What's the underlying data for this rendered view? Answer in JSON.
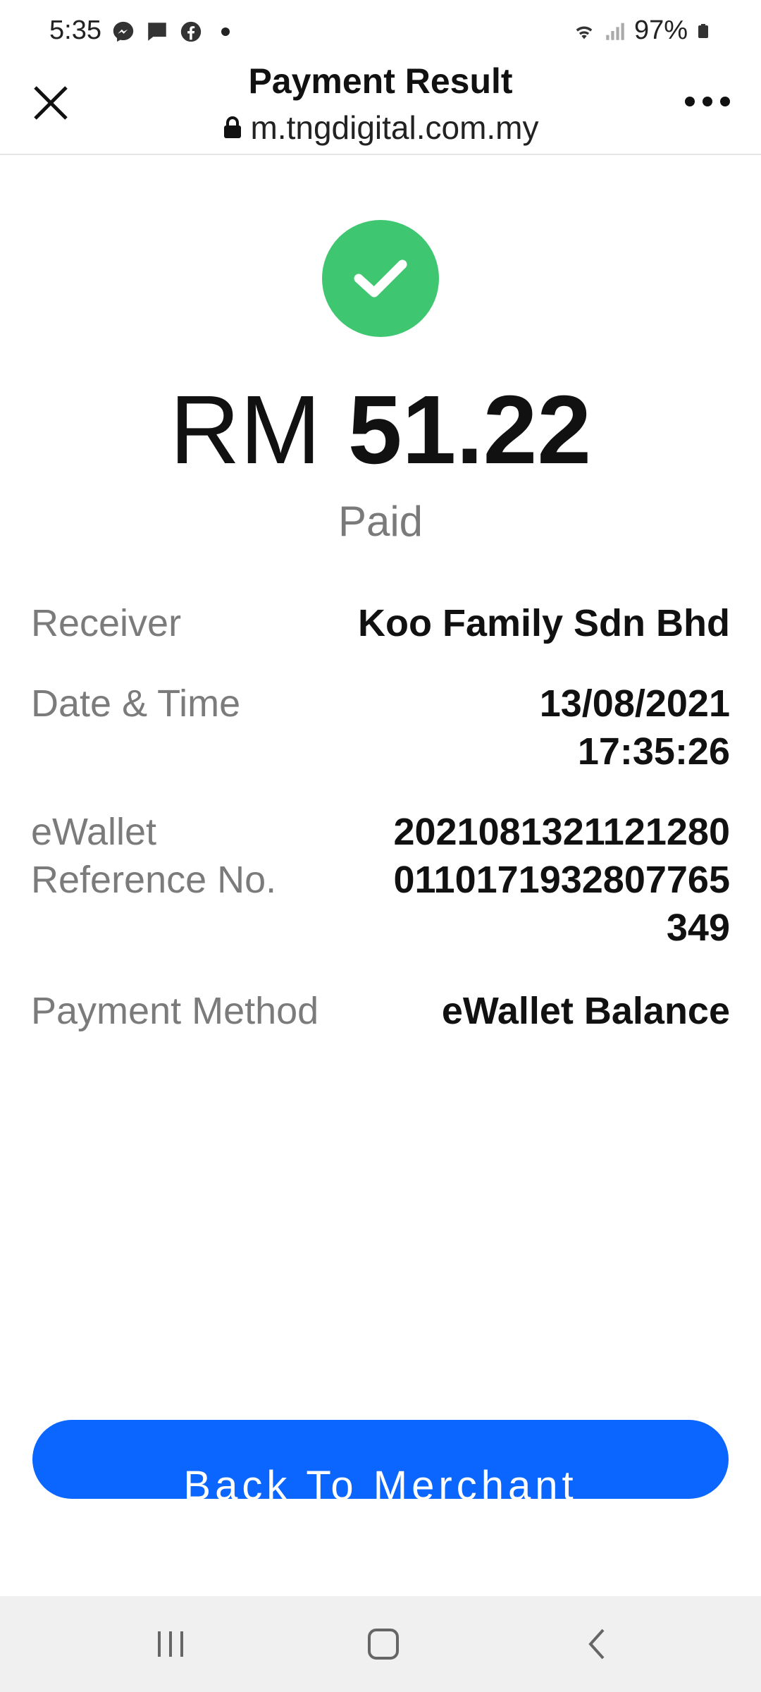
{
  "status_bar": {
    "time": "5:35",
    "battery": "97%",
    "icons": [
      "messenger-icon",
      "message-icon",
      "facebook-icon",
      "notification-dot",
      "wifi-icon",
      "signal-icon",
      "battery-icon"
    ]
  },
  "header": {
    "title": "Payment Result",
    "url": "m.tngdigital.com.my"
  },
  "payment": {
    "currency": "RM",
    "amount": "51.22",
    "status": "Paid"
  },
  "details": [
    {
      "label": "Receiver",
      "value": "Koo Family Sdn Bhd"
    },
    {
      "label": "Date & Time",
      "value_lines": [
        "13/08/2021",
        "17:35:26"
      ]
    },
    {
      "label_lines": [
        "eWallet",
        "Reference No."
      ],
      "value_lines": [
        "2021081321121280",
        "0110171932807765",
        "349"
      ]
    },
    {
      "label": "Payment Method",
      "value": "eWallet Balance"
    }
  ],
  "actions": {
    "back_label": "Back To Merchant"
  },
  "colors": {
    "success": "#3ec770",
    "primary_button": "#0a66ff",
    "label_gray": "#7b7b7b"
  }
}
